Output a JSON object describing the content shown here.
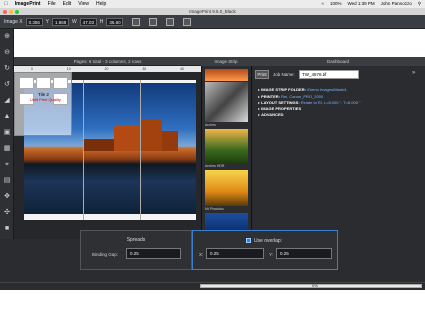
{
  "menubar": {
    "app_name": "ImagePrint",
    "menus": [
      "File",
      "Edit",
      "View",
      "Help"
    ],
    "battery": "100%",
    "clock": "Wed 1:39 PM",
    "user": "John Pannozzo"
  },
  "window": {
    "title": "ImagePrint 9.5.0_Black"
  },
  "toolbar": {
    "scale_label": "Image X",
    "scale_value": "0.356",
    "y_label": "Y",
    "y_value": "1.868",
    "w_label": "W",
    "w_value": "47.03",
    "h_label": "H",
    "h_value": "36.60"
  },
  "pages_panel": {
    "header": "Pages: 6 total - 3 columns, 2 rows",
    "ruler_ticks": [
      "0",
      "10",
      "20",
      "30",
      "40"
    ],
    "tile_label": "Tile 2",
    "tile_note": "Unlit Print Quality"
  },
  "image_strip": {
    "header": "Image Strip",
    "captions": [
      "Arches",
      "Arches HDR",
      "Mt Pinatubo",
      "Wildflower",
      "Windmill"
    ]
  },
  "dashboard": {
    "header": "Dashboard",
    "print_button": "Print",
    "job_label": "Job Name:",
    "job_name": "TW_4676.tif",
    "rows": [
      {
        "label": "IMAGE STRIP FOLDER:",
        "value": "/Demo Images/Mark/4"
      },
      {
        "label": "PRINTER:",
        "value": "Rei, Canon_PRO_2000"
      },
      {
        "label": "LAYOUT SETTINGS:",
        "value": "Relate to Rl, L=8.000 \", T=8.000 \""
      },
      {
        "label": "IMAGE PROPERTIES",
        "value": ""
      },
      {
        "label": "ADVANCED",
        "value": ""
      }
    ]
  },
  "spreads": {
    "title": "Spreads",
    "gap_label": "Binding Gap:",
    "gap_value": "0.25"
  },
  "overlap": {
    "label": "Use overlap:",
    "checked": true,
    "x_label": "X:",
    "x_value": "0.25",
    "y_label": "Y:",
    "y_value": "0.25"
  },
  "status": {
    "progress_text": "0%",
    "progress_fraction": 0
  },
  "colors": {
    "accent": "#3a7fd1",
    "panel_bg": "#2a2c30"
  },
  "left_tools": [
    "zoom-in-icon",
    "zoom-out-icon",
    "rotate-icon",
    "rotate-reverse-icon",
    "triangle-icon",
    "mirror-icon",
    "crop-icon",
    "grid-icon",
    "target-icon",
    "ruler-icon",
    "move-icon",
    "mask-icon",
    "swap-icon"
  ]
}
